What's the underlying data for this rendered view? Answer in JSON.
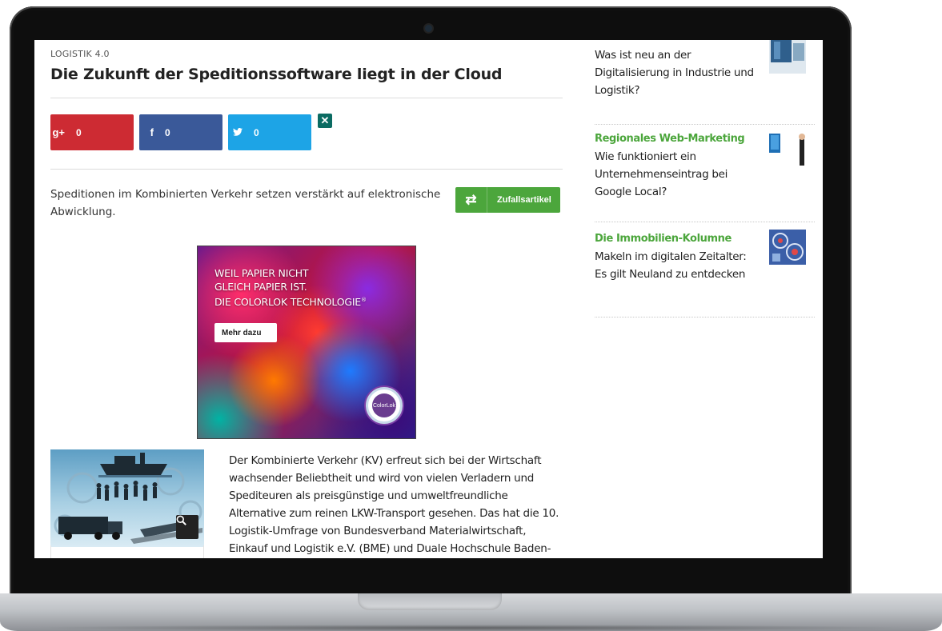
{
  "article": {
    "kicker": "LOGISTIK 4.0",
    "title": "Die Zukunft der Speditionssoftware liegt in der Cloud",
    "teaser": "Speditionen im Kombinierten Verkehr setzen verstärkt auf elektronische Abwicklung.",
    "body": "Der Kombinierte Verkehr (KV) erfreut sich bei der Wirtschaft wachsender Beliebtheit und wird von vielen Verladern und Spediteuren als preisgünstige und umweltfreundliche Alternative zum reinen LKW-Transport gesehen. Das hat die 10. Logistik-Umfrage von Bundesverband Materialwirtschaft, Einkauf und Logistik e.V. (BME) und Duale Hochschule Baden-Württemberg in"
  },
  "share": {
    "gplus": {
      "icon": "g+",
      "count": "0",
      "color": "#cd2b33"
    },
    "facebook": {
      "icon": "f",
      "count": "0",
      "color": "#3a5999"
    },
    "twitter": {
      "icon": "🐦",
      "count": "0",
      "color": "#1da4e6"
    },
    "xing": {
      "icon": "✕"
    }
  },
  "random_button": {
    "label": "Zufallsartikel",
    "icon": "⇄",
    "color": "#4ca63c"
  },
  "ad": {
    "line1": "WEIL PAPIER NICHT",
    "line2": "GLEICH PAPIER IST.",
    "line3": "DIE COLORLOK TECHNOLOGIE",
    "reg": "®",
    "button": "Mehr dazu",
    "logo_text": "ColorLok"
  },
  "image": {
    "zoom_icon": "🔍"
  },
  "sidebar": {
    "items": [
      {
        "category": "",
        "text": "Was ist neu an der Digitalisierung in Industrie und Logistik?"
      },
      {
        "category": "Regionales Web-Marketing",
        "text": "Wie funktioniert ein Unternehmenseintrag bei Google Local?"
      },
      {
        "category": "Die Immobilien-Kolumne",
        "text": "Makeln im digitalen Zeitalter: Es gilt Neuland zu entdecken"
      }
    ]
  }
}
